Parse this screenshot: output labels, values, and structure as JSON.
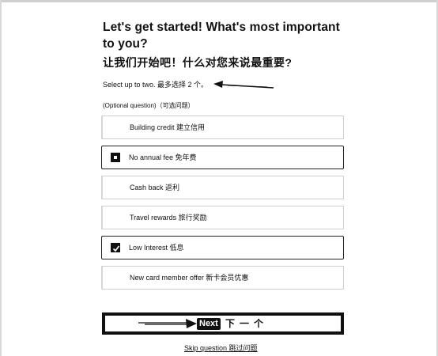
{
  "header": {
    "title_en": "Let's get started! What's most important to you?",
    "title_zh": "让我们开始吧！什么对您来说最重要?",
    "subtitle": "Select up to two. 最多选择 2 个。"
  },
  "question": {
    "optional_label": "(Optional question)（可选问题）"
  },
  "options": [
    {
      "label": "Building credit 建立信用",
      "selected": false,
      "checkbox": "none"
    },
    {
      "label": "No annual fee 免年费",
      "selected": true,
      "checkbox": "empty"
    },
    {
      "label": "Cash back 返利",
      "selected": false,
      "checkbox": "none"
    },
    {
      "label": "Travel rewards 旅行奖励",
      "selected": false,
      "checkbox": "none"
    },
    {
      "label": "Low Interest 低息",
      "selected": true,
      "checkbox": "checked"
    },
    {
      "label": "New card member offer 新卡会员优惠",
      "selected": false,
      "checkbox": "none"
    }
  ],
  "actions": {
    "next_label": "Next",
    "next_label_zh": "下一个",
    "skip_label": "Skip question 跳过问题"
  },
  "icons": {
    "subtitle_annotation": "arrow-left-icon",
    "next_annotation": "arrow-right-icon",
    "checkbox_checked": "checkmark-icon"
  },
  "colors": {
    "text": "#111111",
    "border": "#cfcfcf",
    "selected_border": "#222222",
    "background": "#ffffff"
  }
}
